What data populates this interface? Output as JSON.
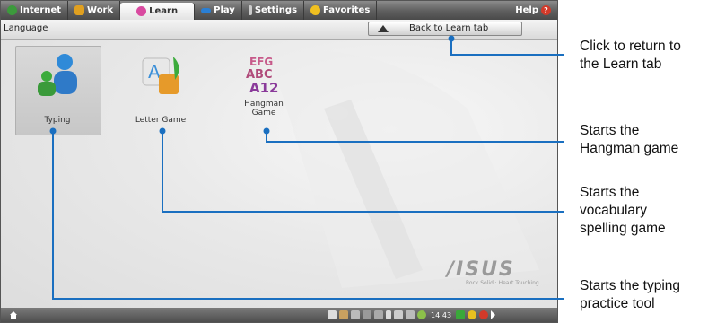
{
  "tabs": [
    {
      "label": "Internet",
      "color": "#3c9a3c"
    },
    {
      "label": "Work",
      "color": "#e0a020"
    },
    {
      "label": "Learn",
      "color": "#d94aa0"
    },
    {
      "label": "Play",
      "color": "#2a7fd4"
    },
    {
      "label": "Settings",
      "color": "#cccccc"
    },
    {
      "label": "Favorites",
      "color": "#f0c020"
    }
  ],
  "help_label": "Help",
  "subbar": {
    "title": "Language",
    "back_label": "Back to Learn tab"
  },
  "apps": [
    {
      "label": "Typing"
    },
    {
      "label": "Letter Game"
    },
    {
      "label_line1": "Hangman",
      "label_line2": "Game"
    }
  ],
  "brand": "/ISUS",
  "brand_sub": "Rock Solid · Heart Touching",
  "taskbar": {
    "clock": "14:43"
  },
  "callouts": {
    "back_line1": "Click to return to",
    "back_line2": "the Learn tab",
    "hangman_line1": "Starts the",
    "hangman_line2": "Hangman game",
    "letter_line1": "Starts the",
    "letter_line2": "vocabulary",
    "letter_line3": "spelling game",
    "typing_line1": "Starts the typing",
    "typing_line2": "practice tool"
  }
}
